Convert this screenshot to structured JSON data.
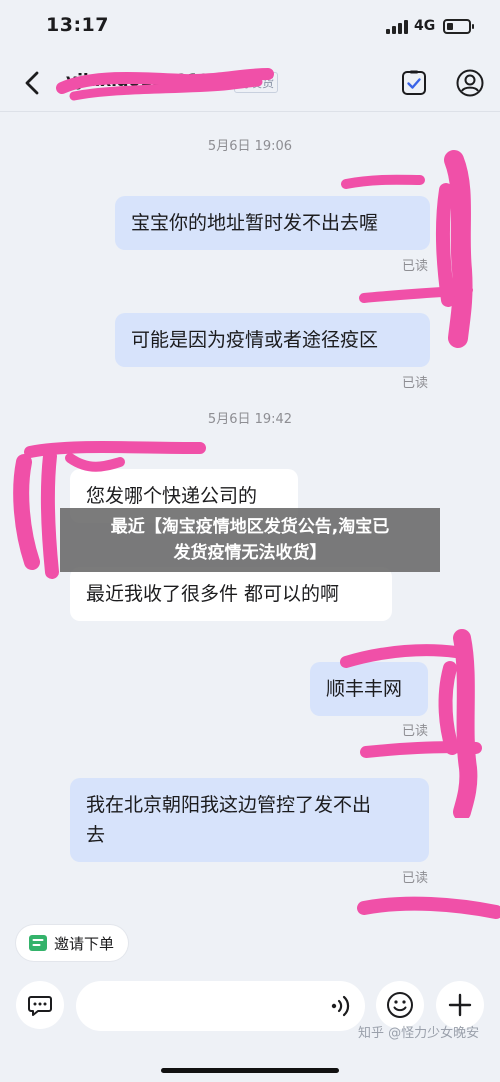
{
  "status": {
    "time": "13:17",
    "network": "4G",
    "battery_level": 0.3
  },
  "header": {
    "contact_name": "yjiaxiao1a8011",
    "tag_label": "待发货"
  },
  "messages": {
    "ts1": "5月6日 19:06",
    "m1": "宝宝你的地址暂时发不出去喔",
    "m1_read": "已读",
    "m2": "可能是因为疫情或者途径疫区",
    "m2_read": "已读",
    "ts2": "5月6日 19:42",
    "m3": "您发哪个快递公司的",
    "m4": "最近我收了很多件 都可以的啊",
    "m5": "顺丰丰网",
    "m5_read": "已读",
    "m6_line1": "我在北京朝阳我这边管控了发不出",
    "m6_line2": "去",
    "m6_read": "已读"
  },
  "overlay": {
    "line1": "最近【淘宝疫情地区发货公告,淘宝已",
    "line2": "发货疫情无法收货】"
  },
  "footer": {
    "invite_label": "邀请下单",
    "watermark": "知乎 @怪力少女晚安"
  },
  "colors": {
    "outgoing_bubble": "#d7e3fb",
    "incoming_bubble": "#ffffff",
    "scribble": "#f050a8",
    "background": "#eef1f6"
  }
}
